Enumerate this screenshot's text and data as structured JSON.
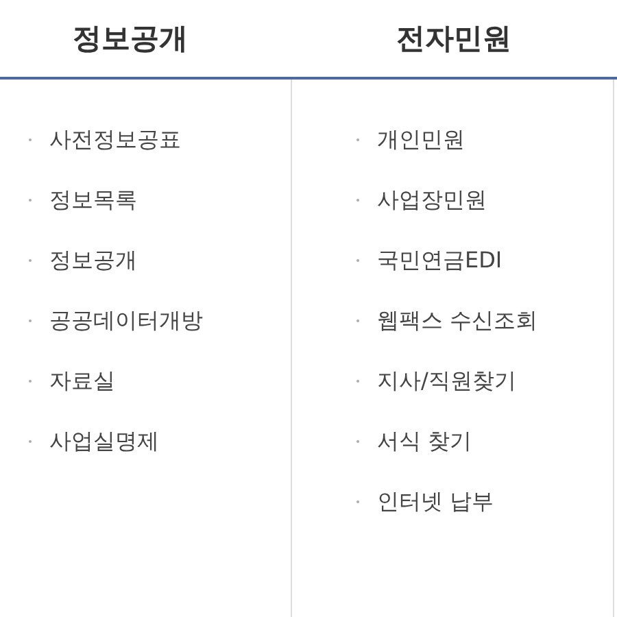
{
  "columns": [
    {
      "title": "정보공개",
      "items": [
        "사전정보공표",
        "정보목록",
        "정보공개",
        "공공데이터개방",
        "자료실",
        "사업실명제"
      ]
    },
    {
      "title": "전자민원",
      "items": [
        "개인민원",
        "사업장민원",
        "국민연금EDI",
        "웹팩스 수신조회",
        "지사/직원찾기",
        "서식 찾기",
        "인터넷 납부"
      ]
    }
  ]
}
